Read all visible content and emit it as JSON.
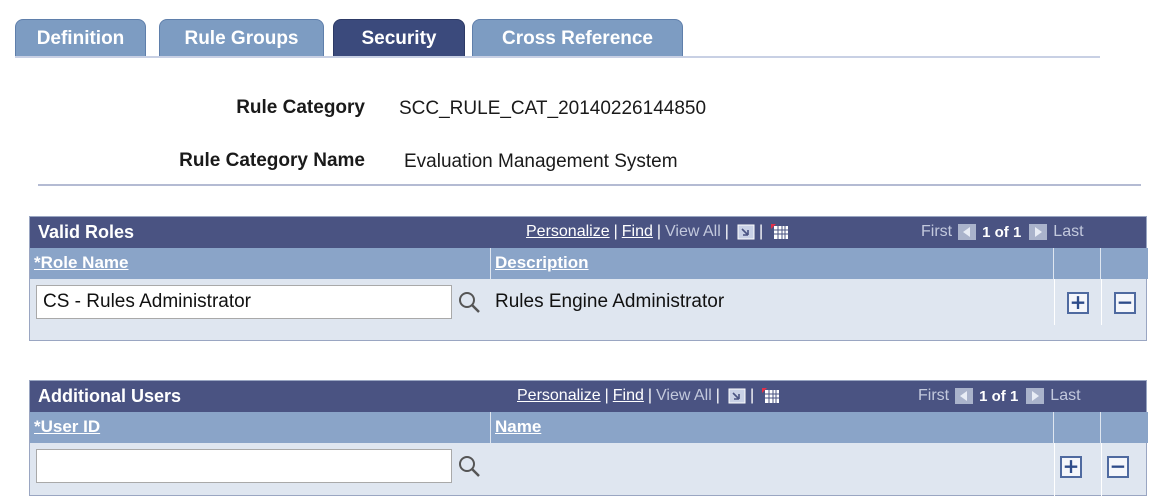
{
  "tabs": [
    {
      "label": "Definition"
    },
    {
      "label": "Rule Groups"
    },
    {
      "label": "Security"
    },
    {
      "label": "Cross Reference"
    }
  ],
  "header": {
    "rule_category_label": "Rule Category",
    "rule_category_value": "SCC_RULE_CAT_20140226144850",
    "rule_category_name_label": "Rule Category Name",
    "rule_category_name_value": "Evaluation Management System"
  },
  "valid_roles": {
    "title": "Valid Roles",
    "nav": {
      "personalize": "Personalize",
      "find": "Find",
      "view_all": "View All",
      "sep": "|"
    },
    "pager": {
      "first": "First",
      "count": "1 of 1",
      "last": "Last"
    },
    "columns": {
      "role_name": "*Role Name",
      "description": "Description"
    },
    "row": {
      "role_name_value": "CS - Rules Administrator",
      "description": "Rules Engine Administrator"
    },
    "add_label": "+",
    "delete_label": "−"
  },
  "additional_users": {
    "title": "Additional Users",
    "nav": {
      "personalize": "Personalize",
      "find": "Find",
      "view_all": "View All",
      "sep": "|"
    },
    "pager": {
      "first": "First",
      "count": "1 of 1",
      "last": "Last"
    },
    "columns": {
      "user_id": "*User ID",
      "name": "Name"
    },
    "row": {
      "user_id_value": "",
      "name": ""
    },
    "add_label": "+",
    "delete_label": "−"
  },
  "colors": {
    "active_tab": "#3b4a7c",
    "inactive_tab": "#7d9cc2",
    "grid_header": "#4a5382",
    "column_header": "#8aa4c8",
    "grid_body": "#dfe6f0"
  },
  "icons": [
    "search-icon",
    "download-icon",
    "grid-view-icon",
    "arrow-left-icon",
    "arrow-right-icon"
  ]
}
